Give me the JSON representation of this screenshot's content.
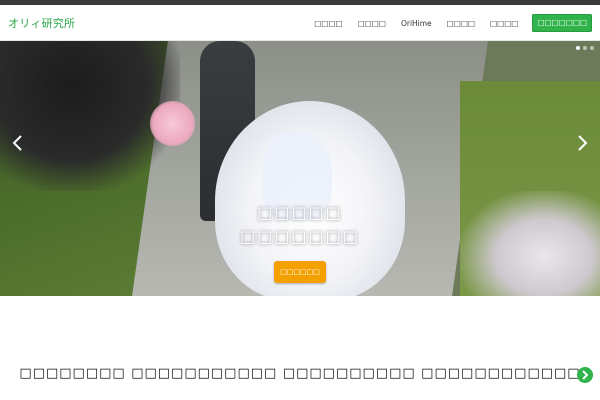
{
  "header": {
    "logo": "オリィ研究所",
    "nav": [
      "□□□□",
      "□□□□",
      "OriHime",
      "□□□□",
      "□□□□"
    ],
    "cta": "□□□□□□□"
  },
  "hero": {
    "title_line1": "□□□□□",
    "title_line2": "□□□□□□□",
    "button": "□□□□□□",
    "slides_total": 3,
    "slide_active": 1
  },
  "bottom": {
    "text": "□□□□□□□□ □□□□□□□□□□□ □□□□□□□□□□ □□□□□□□□□□□□"
  },
  "colors": {
    "brand_green": "#2fb34a",
    "accent_orange": "#f4a000"
  }
}
